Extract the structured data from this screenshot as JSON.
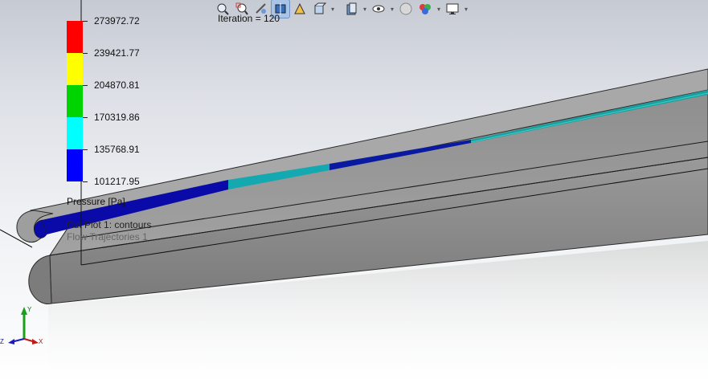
{
  "iteration": "Iteration = 120",
  "legend": {
    "values": [
      "273972.72",
      "239421.77",
      "204870.81",
      "170319.86",
      "135768.91",
      "101217.95"
    ],
    "colors": [
      "#ff0000",
      "#ffff00",
      "#00d400",
      "#00ffff",
      "#0000ff"
    ],
    "title": "Pressure [Pa]"
  },
  "plots": {
    "cut_plot": "Cut Plot 1: contours",
    "flow_trajectories": "Flow Trajectories 1"
  },
  "triad": {
    "x": "X",
    "y": "Y",
    "z": "Z"
  },
  "toolbar": {
    "icons": [
      "zoom-to-fit-icon",
      "zoom-area-icon",
      "previous-view-icon",
      "section-view-icon",
      "dynamic-annotation-icon",
      "view-orientation-icon",
      "display-style-icon",
      "hide-show-items-icon",
      "edit-appearance-icon",
      "apply-scene-icon",
      "view-settings-icon"
    ]
  }
}
